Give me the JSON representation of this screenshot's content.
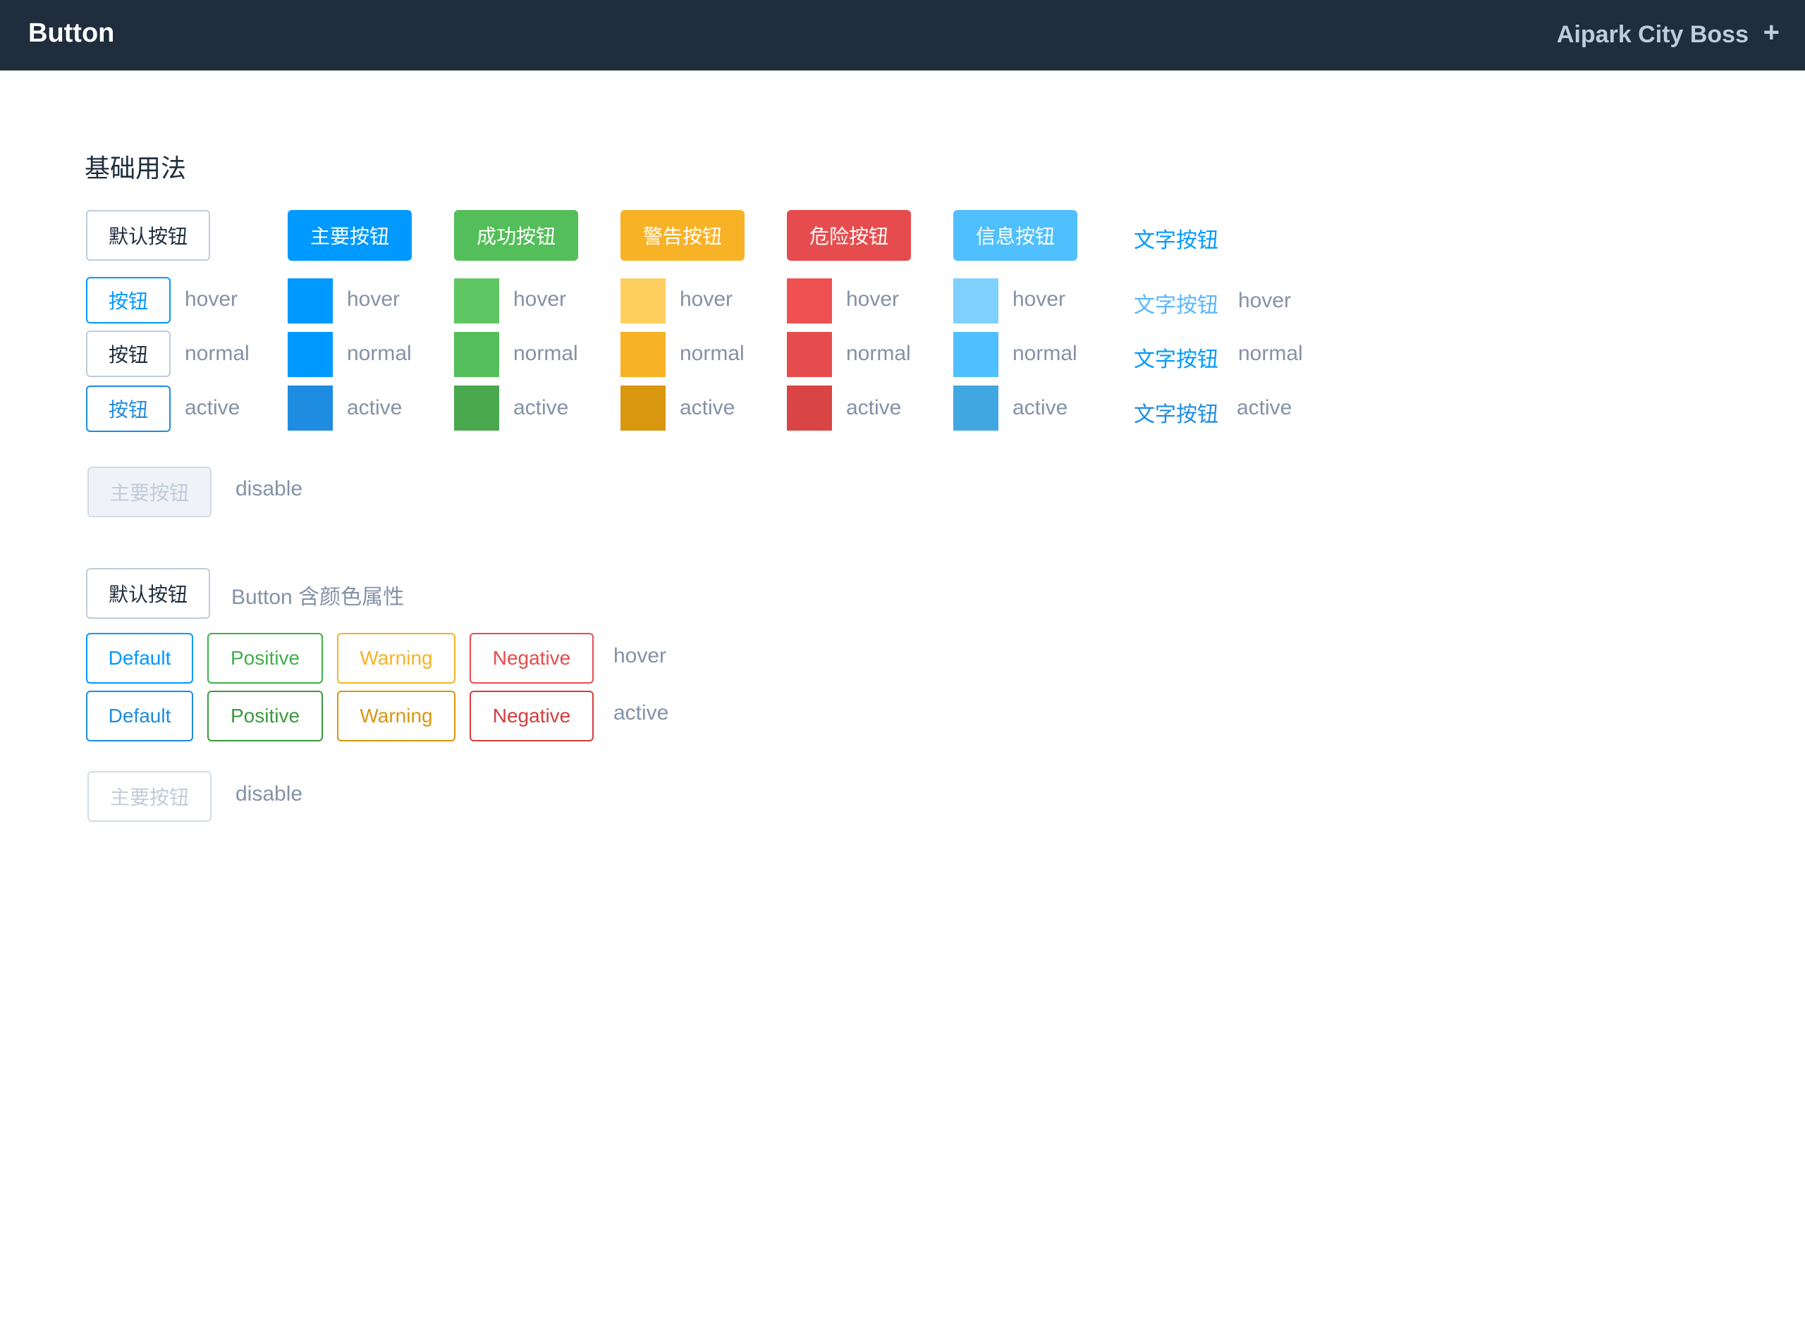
{
  "header": {
    "title": "Button",
    "brand": "Aipark City Boss",
    "add_icon": "plus-icon"
  },
  "section": {
    "title": "基础用法"
  },
  "basic_buttons": {
    "default": "默认按钮",
    "primary": "主要按钮",
    "success": "成功按钮",
    "warning": "警告按钮",
    "danger": "危险按钮",
    "info": "信息按钮",
    "text": "文字按钮"
  },
  "state_labels": {
    "hover": "hover",
    "normal": "normal",
    "active": "active",
    "disable": "disable"
  },
  "small_button_label": "按钮",
  "text_button_label": "文字按钮",
  "disabled_button_label": "主要按钮",
  "colors": {
    "primary": {
      "hover": "#0099ff",
      "normal": "#0099ff",
      "active": "#1e8ce0"
    },
    "success": {
      "hover": "#5fc663",
      "normal": "#54be5a",
      "active": "#4aa84e"
    },
    "warning": {
      "hover": "#fecf5f",
      "normal": "#f7b225",
      "active": "#d9960f"
    },
    "danger": {
      "hover": "#ef5052",
      "normal": "#e64c4d",
      "active": "#d94444"
    },
    "info": {
      "hover": "#7fd0fd",
      "normal": "#50bffd",
      "active": "#41a7e0"
    },
    "text": {
      "hover": "#58b7ff",
      "normal": "#0099ff",
      "active": "#1e8ce0"
    }
  },
  "color_section": {
    "default_button": "默认按钮",
    "description": "Button 含颜色属性",
    "labels": [
      "Default",
      "Positive",
      "Warning",
      "Negative"
    ],
    "hover_label": "hover",
    "active_label": "active",
    "disabled_button": "主要按钮",
    "disable_label": "disable",
    "hover_colors": [
      "#0099ff",
      "#3fb04a",
      "#f7b225",
      "#e64c4d"
    ],
    "active_colors": [
      "#1e8ce0",
      "#3a9a3f",
      "#d9960f",
      "#d33e3e"
    ]
  }
}
